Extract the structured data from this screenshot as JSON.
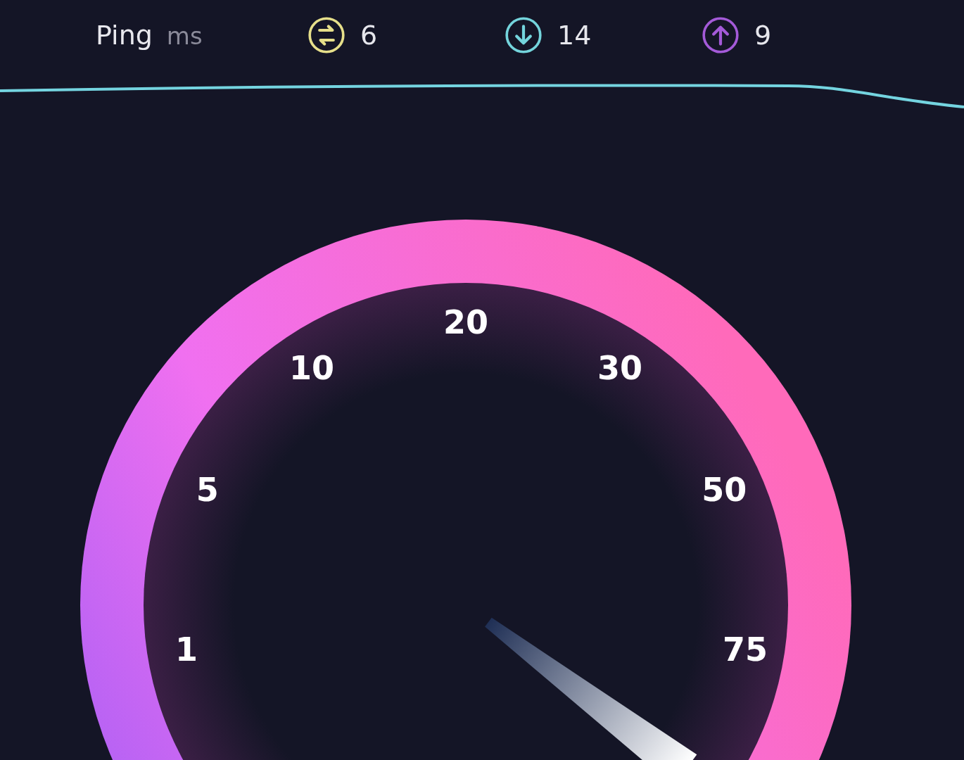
{
  "header": {
    "label": "Ping",
    "unit": "ms",
    "stats": [
      {
        "kind": "ping",
        "value": "6"
      },
      {
        "kind": "download",
        "value": "14"
      },
      {
        "kind": "upload",
        "value": "9"
      }
    ]
  },
  "gauge": {
    "labels": [
      "1",
      "5",
      "10",
      "20",
      "30",
      "50",
      "75"
    ]
  }
}
